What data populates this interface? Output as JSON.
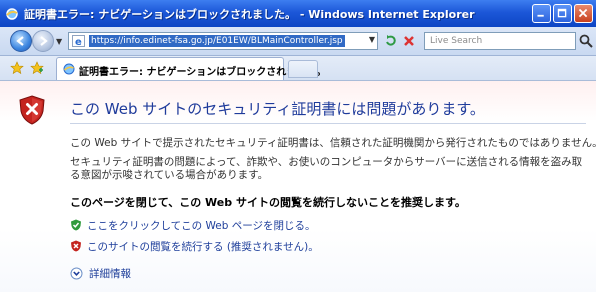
{
  "window": {
    "title": "証明書エラー: ナビゲーションはブロックされました。 - Windows Internet Explorer"
  },
  "address": {
    "url": "https://info.edinet-fsa.go.jp/E01EW/BLMainController.jsp"
  },
  "search": {
    "placeholder": "Live Search"
  },
  "tab": {
    "title": "証明書エラー: ナビゲーションはブロックされました。"
  },
  "page": {
    "heading": "この Web サイトのセキュリティ証明書には問題があります。",
    "paragraph1": "この Web サイトで提示されたセキュリティ証明書は、信頼された証明機関から発行されたものではありません。",
    "paragraph2": "セキュリティ証明書の問題によって、詐欺や、お使いのコンピュータからサーバーに送信される情報を盗み取る意図が示唆されている場合があります。",
    "recommendation": "このページを閉じて、この Web サイトの閲覧を続行しないことを推奨します。",
    "close_link": "ここをクリックしてこの Web ページを閉じる。",
    "continue_link": "このサイトの閲覧を続行する (推奨されません)。",
    "more_info": "詳細情報"
  },
  "colors": {
    "titlebar": "#1c57d8",
    "link": "#1f3f9b",
    "heading": "#1f3b9b",
    "danger": "#c4241f",
    "safe": "#2f9a3c"
  },
  "icons": {
    "shield": "security-shield-icon",
    "ie": "internet-explorer-icon"
  }
}
